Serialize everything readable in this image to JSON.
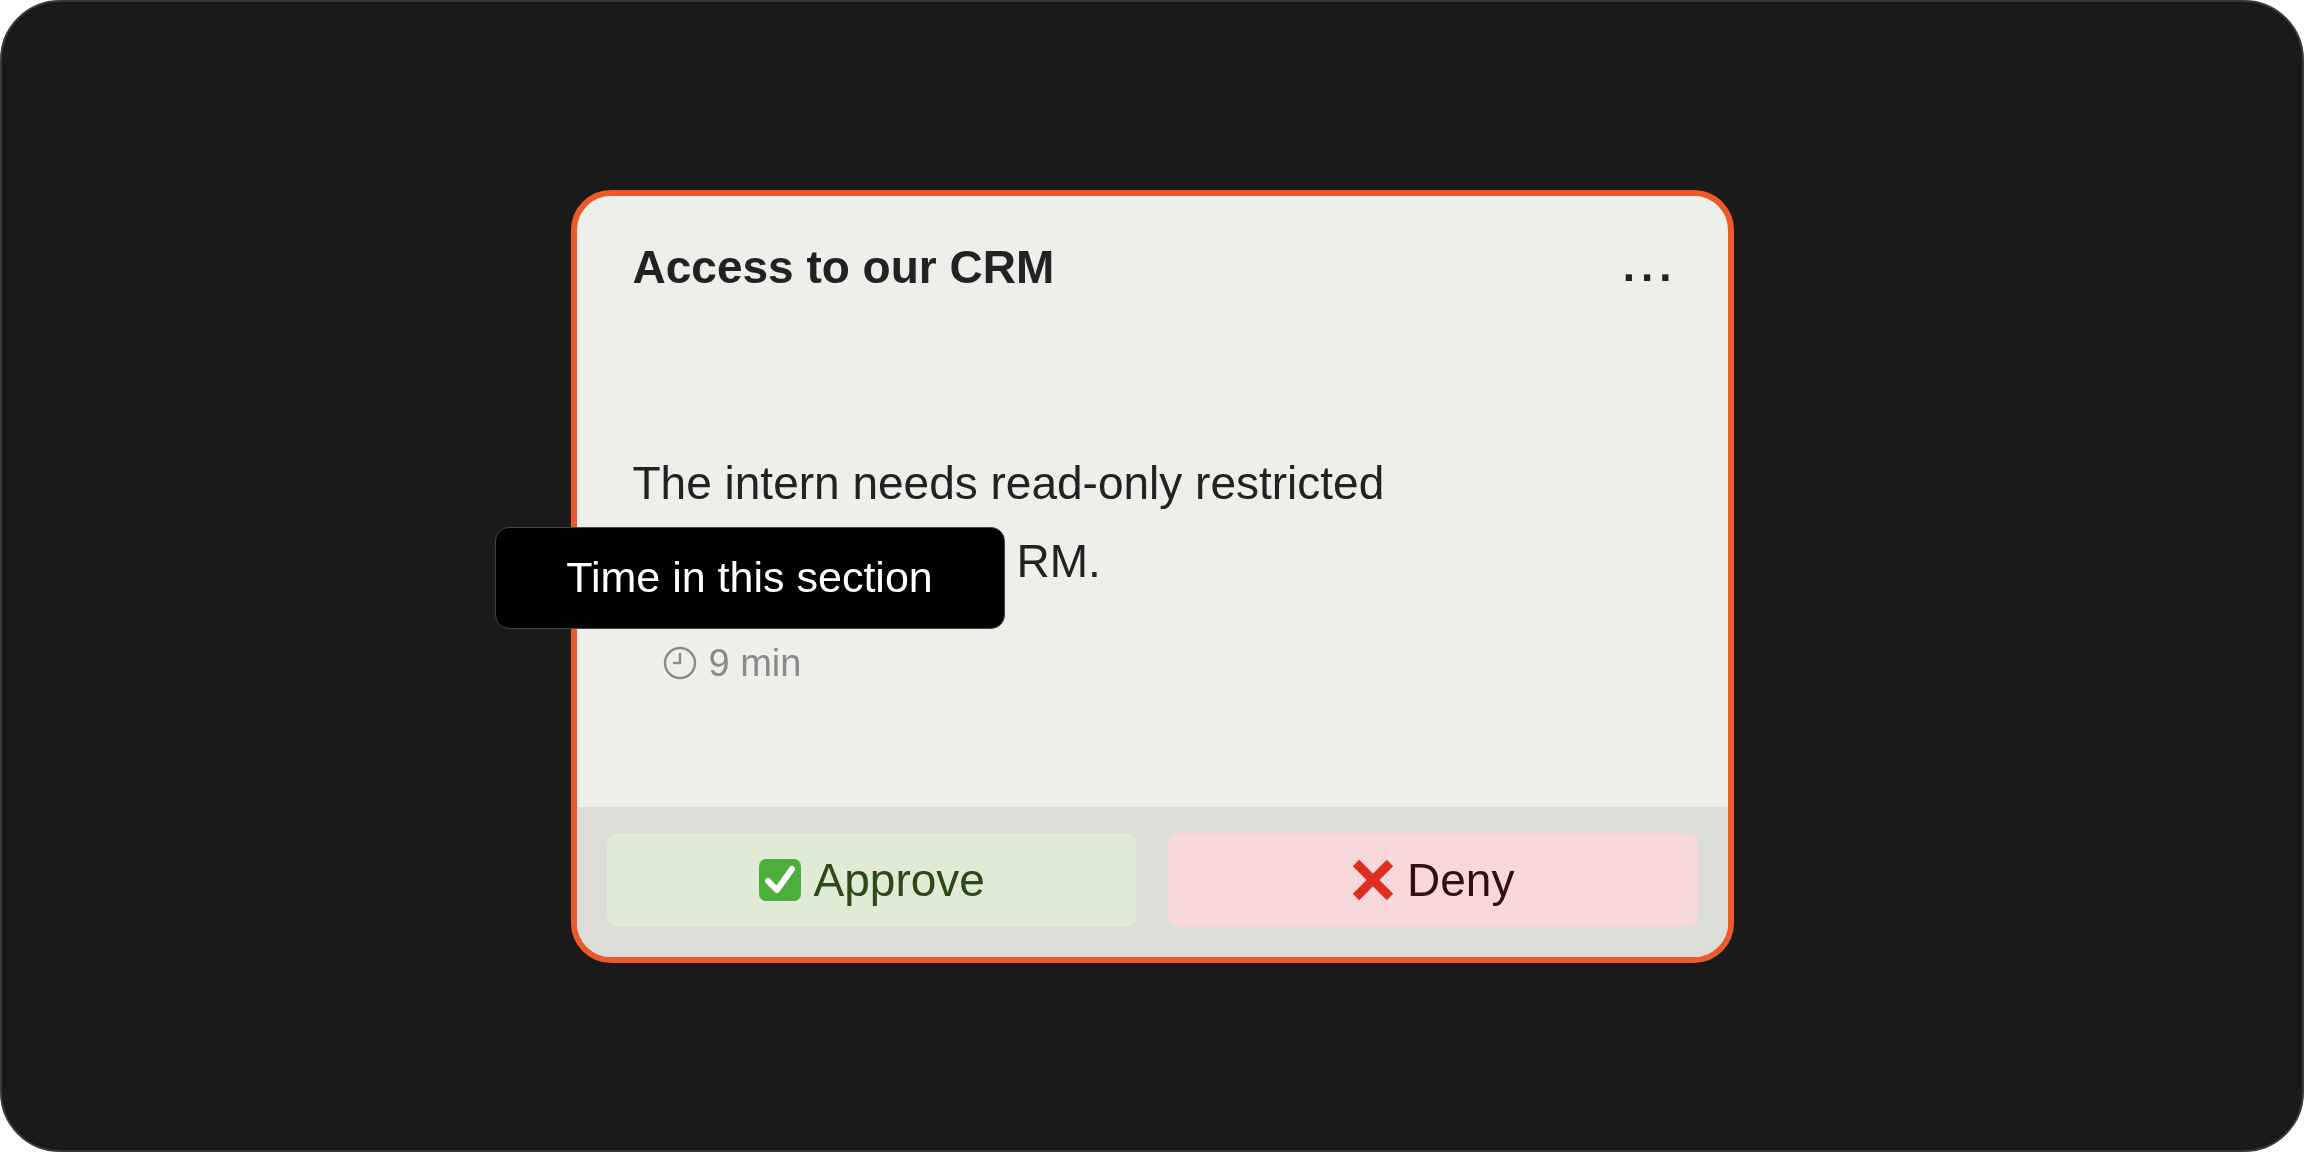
{
  "card": {
    "title": "Access to our CRM",
    "more_label": "...",
    "description_lines": [
      "The intern needs read-only restricted",
      "RM."
    ],
    "time": "9 min"
  },
  "tooltip": {
    "text": "Time in this section"
  },
  "actions": [
    {
      "kind": "approve",
      "label": "Approve"
    },
    {
      "kind": "deny",
      "label": "Deny"
    }
  ]
}
